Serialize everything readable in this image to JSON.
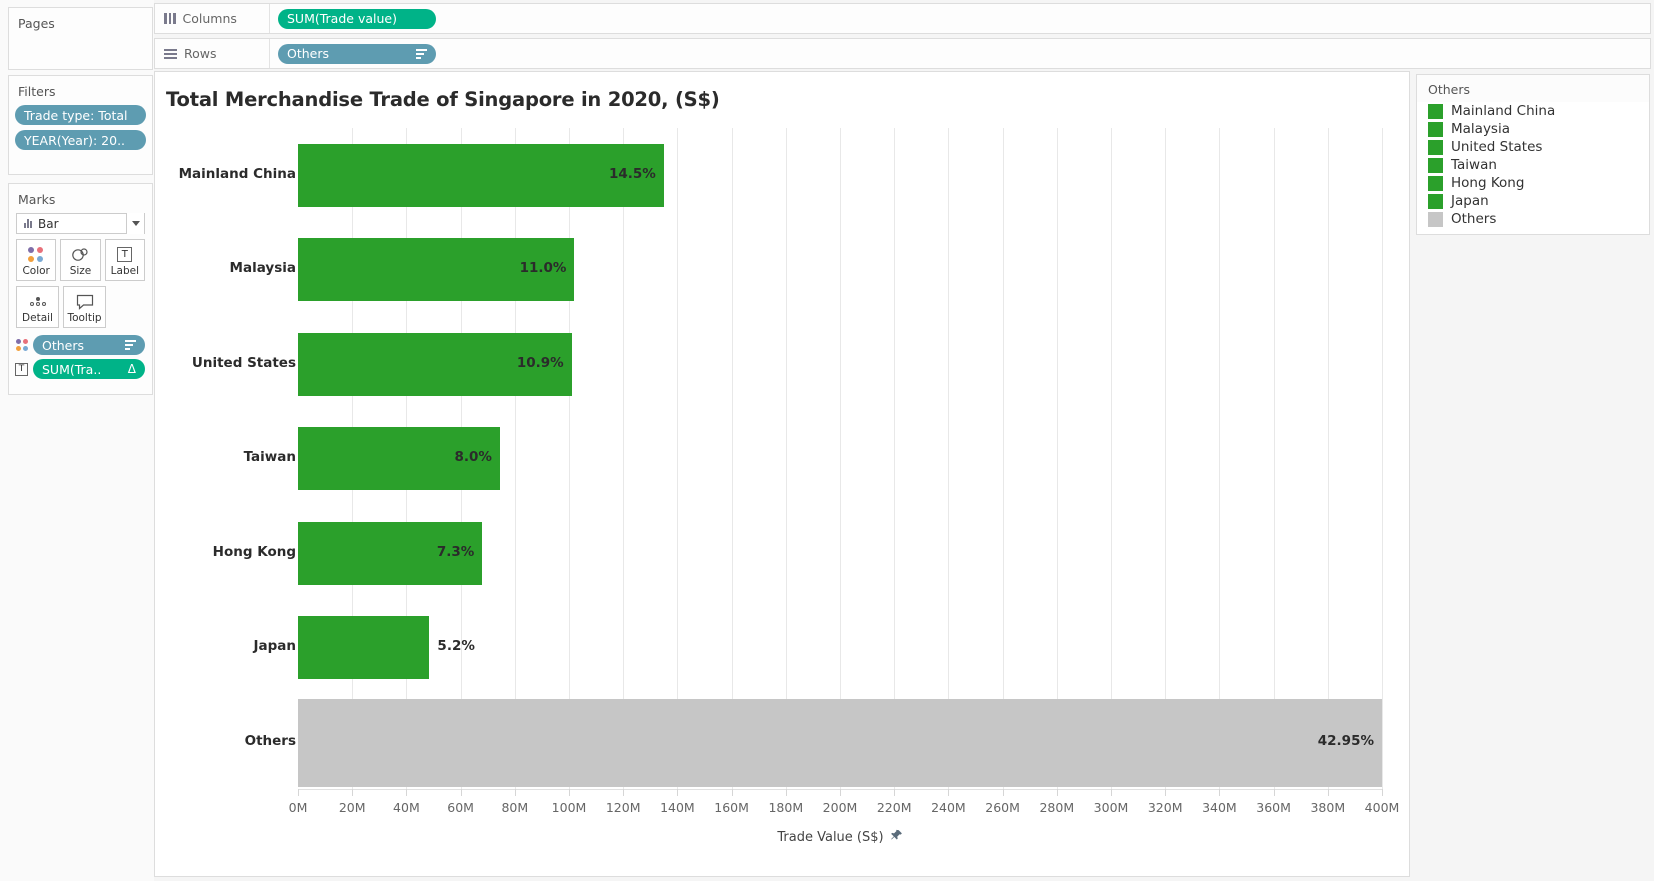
{
  "shelves": {
    "pages": {
      "label": "Pages"
    },
    "filters": {
      "label": "Filters",
      "pills": [
        "Trade type: Total",
        "YEAR(Year): 20.."
      ]
    },
    "columns": {
      "label": "Columns",
      "pill": "SUM(Trade value)",
      "icon": "columns-icon"
    },
    "rows": {
      "label": "Rows",
      "pill": "Others",
      "icon": "rows-icon"
    }
  },
  "marks": {
    "label": "Marks",
    "type": "Bar",
    "buttons": [
      {
        "label": "Color",
        "icon": "color-icon"
      },
      {
        "label": "Size",
        "icon": "size-icon"
      },
      {
        "label": "Label",
        "icon": "label-icon"
      },
      {
        "label": "Detail",
        "icon": "detail-icon"
      },
      {
        "label": "Tooltip",
        "icon": "tooltip-icon"
      }
    ],
    "pills": [
      {
        "text": "Others",
        "lead": "color-icon",
        "kind": "blue",
        "suffix": "sort-icon"
      },
      {
        "text": "SUM(Tra..",
        "lead": "label-icon",
        "kind": "green",
        "suffix": "Δ"
      }
    ]
  },
  "view": {
    "title": "Total Merchandise Trade of Singapore in 2020, (S$)"
  },
  "legend": {
    "title": "Others",
    "items": [
      {
        "label": "Mainland China",
        "color": "#2ba02b"
      },
      {
        "label": "Malaysia",
        "color": "#2ba02b"
      },
      {
        "label": "United States",
        "color": "#2ba02b"
      },
      {
        "label": "Taiwan",
        "color": "#2ba02b"
      },
      {
        "label": "Hong Kong",
        "color": "#2ba02b"
      },
      {
        "label": "Japan",
        "color": "#2ba02b"
      },
      {
        "label": "Others",
        "color": "#c6c6c6"
      }
    ]
  },
  "colors": {
    "bar_green": "#2ba02b",
    "bar_gray": "#c6c6c6",
    "pill_blue": "#5e9cb1",
    "pill_green": "#00b388"
  },
  "chart_data": {
    "type": "bar",
    "orientation": "horizontal",
    "title": "Total Merchandise Trade of Singapore in 2020, (S$)",
    "xlabel": "Trade Value (S$)",
    "ylabel": "",
    "xlim": [
      0,
      400000000
    ],
    "xticks": [
      "0M",
      "20M",
      "40M",
      "60M",
      "80M",
      "100M",
      "120M",
      "140M",
      "160M",
      "180M",
      "200M",
      "220M",
      "240M",
      "260M",
      "280M",
      "300M",
      "320M",
      "340M",
      "360M",
      "380M",
      "400M"
    ],
    "grid": true,
    "legend_position": "right",
    "legend_title": "Others",
    "categories": [
      "Mainland China",
      "Malaysia",
      "United States",
      "Taiwan",
      "Hong Kong",
      "Japan",
      "Others"
    ],
    "values": [
      135000000,
      102000000,
      101000000,
      74500000,
      68000000,
      48500000,
      400000000
    ],
    "data_labels": [
      "14.5%",
      "11.0%",
      "10.9%",
      "8.0%",
      "7.3%",
      "5.2%",
      "42.95%"
    ],
    "colors": [
      "#2ba02b",
      "#2ba02b",
      "#2ba02b",
      "#2ba02b",
      "#2ba02b",
      "#2ba02b",
      "#c6c6c6"
    ],
    "label_inside": [
      true,
      true,
      true,
      true,
      true,
      false,
      true
    ]
  }
}
